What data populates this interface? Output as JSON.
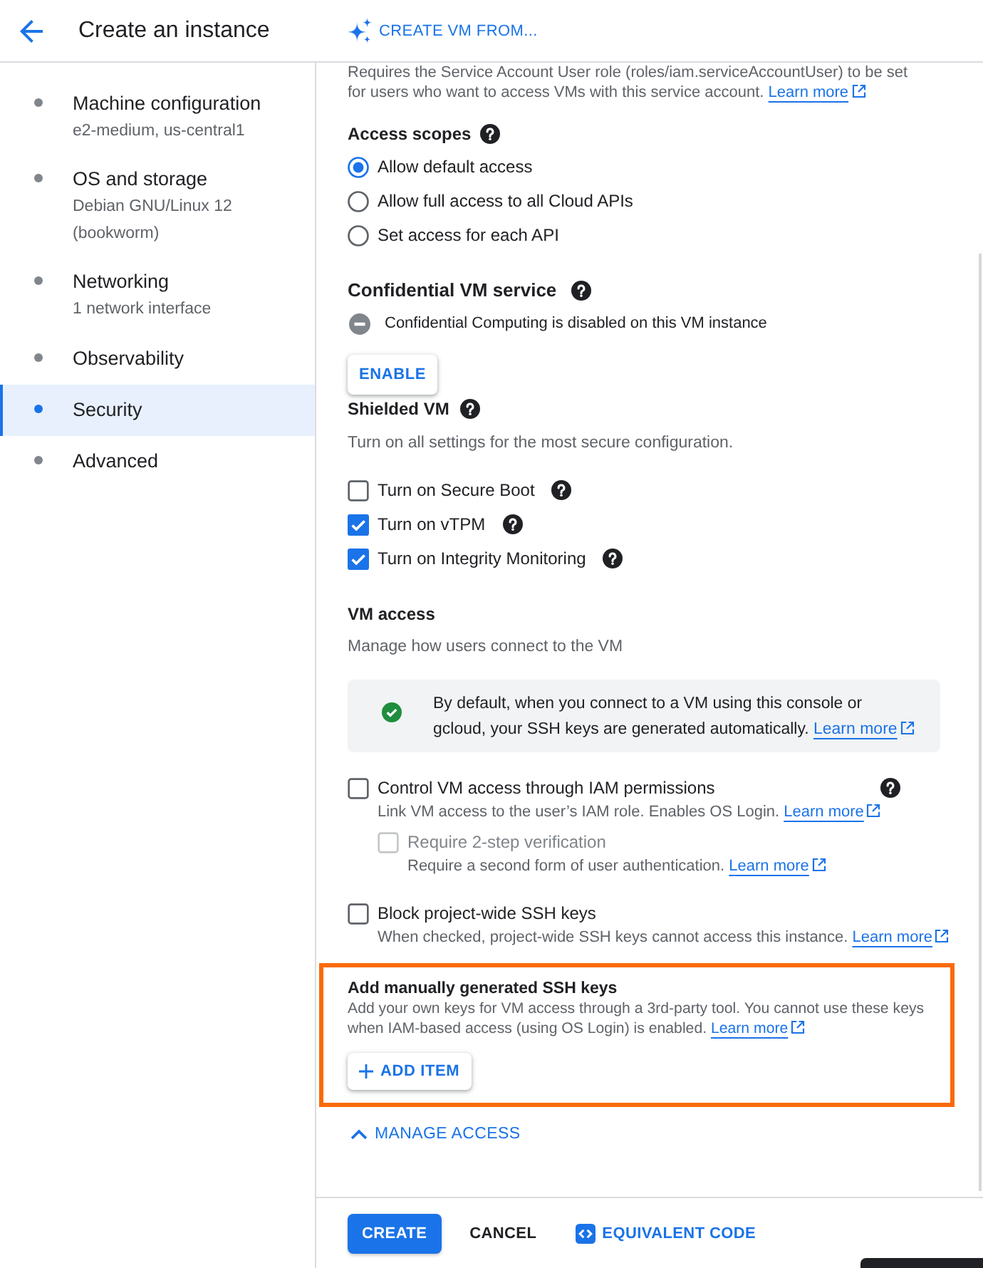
{
  "header": {
    "title": "Create an instance",
    "action": "CREATE VM FROM..."
  },
  "sidebar": {
    "items": [
      {
        "label": "Machine configuration",
        "subtitle": "e2-medium, us-central1",
        "selected": false
      },
      {
        "label": "OS and storage",
        "subtitle": "Debian GNU/Linux 12 (bookworm)",
        "selected": false
      },
      {
        "label": "Networking",
        "subtitle": "1 network interface",
        "selected": false
      },
      {
        "label": "Observability",
        "selected": false
      },
      {
        "label": "Security",
        "selected": true
      },
      {
        "label": "Advanced",
        "selected": false
      }
    ]
  },
  "service_account_note": {
    "text": "Requires the Service Account User role (roles/iam.serviceAccountUser) to be set for users who want to access VMs with this service account.",
    "link": "Learn more"
  },
  "access_scopes": {
    "title": "Access scopes",
    "help": true,
    "options": [
      {
        "label": "Allow default access",
        "selected": true
      },
      {
        "label": "Allow full access to all Cloud APIs",
        "selected": false
      },
      {
        "label": "Set access for each API",
        "selected": false
      }
    ]
  },
  "confidential_vm": {
    "title": "Confidential VM service",
    "help": true,
    "status": "Confidential Computing is disabled on this VM instance",
    "button": "ENABLE"
  },
  "shielded_vm": {
    "title": "Shielded VM",
    "help": true,
    "description": "Turn on all settings for the most secure configuration.",
    "options": [
      {
        "label": "Turn on Secure Boot",
        "checked": false,
        "disabled": false,
        "help": true
      },
      {
        "label": "Turn on vTPM",
        "checked": true,
        "disabled": false,
        "help": true
      },
      {
        "label": "Turn on Integrity Monitoring",
        "checked": true,
        "disabled": false,
        "help": true
      }
    ]
  },
  "vm_access": {
    "title": "VM access",
    "help": false,
    "description": "Manage how users connect to the VM",
    "info": {
      "text": "By default, when you connect to a VM using this console or gcloud, your SSH keys are generated automatically.",
      "link": "Learn more"
    },
    "options": [
      {
        "label": "Control VM access through IAM permissions",
        "checked": false,
        "disabled": false,
        "help": true,
        "description": "Link VM access to the user’s IAM role. Enables OS Login.",
        "link": "Learn more",
        "children": [
          {
            "label": "Require 2-step verification",
            "checked": false,
            "disabled": true,
            "help": false,
            "description": "Require a second form of user authentication.",
            "link": "Learn more"
          }
        ]
      },
      {
        "label": "Block project-wide SSH keys",
        "checked": false,
        "disabled": false,
        "help": false,
        "description": "When checked, project-wide SSH keys cannot access this instance.",
        "link": "Learn more"
      }
    ]
  },
  "ssh_keys": {
    "title": "Add manually generated SSH keys",
    "description": "Add your own keys for VM access through a 3rd-party tool. You cannot use these keys when IAM-based access (using OS Login) is enabled.",
    "link": "Learn more",
    "button": "ADD ITEM",
    "highlighted": true
  },
  "manage_access": {
    "label": "MANAGE ACCESS",
    "expanded": true
  },
  "footer": {
    "buttons": [
      {
        "label": "CREATE",
        "kind": "primary"
      },
      {
        "label": "CANCEL",
        "kind": "plain"
      },
      {
        "label": "EQUIVALENT CODE",
        "kind": "code"
      }
    ]
  }
}
